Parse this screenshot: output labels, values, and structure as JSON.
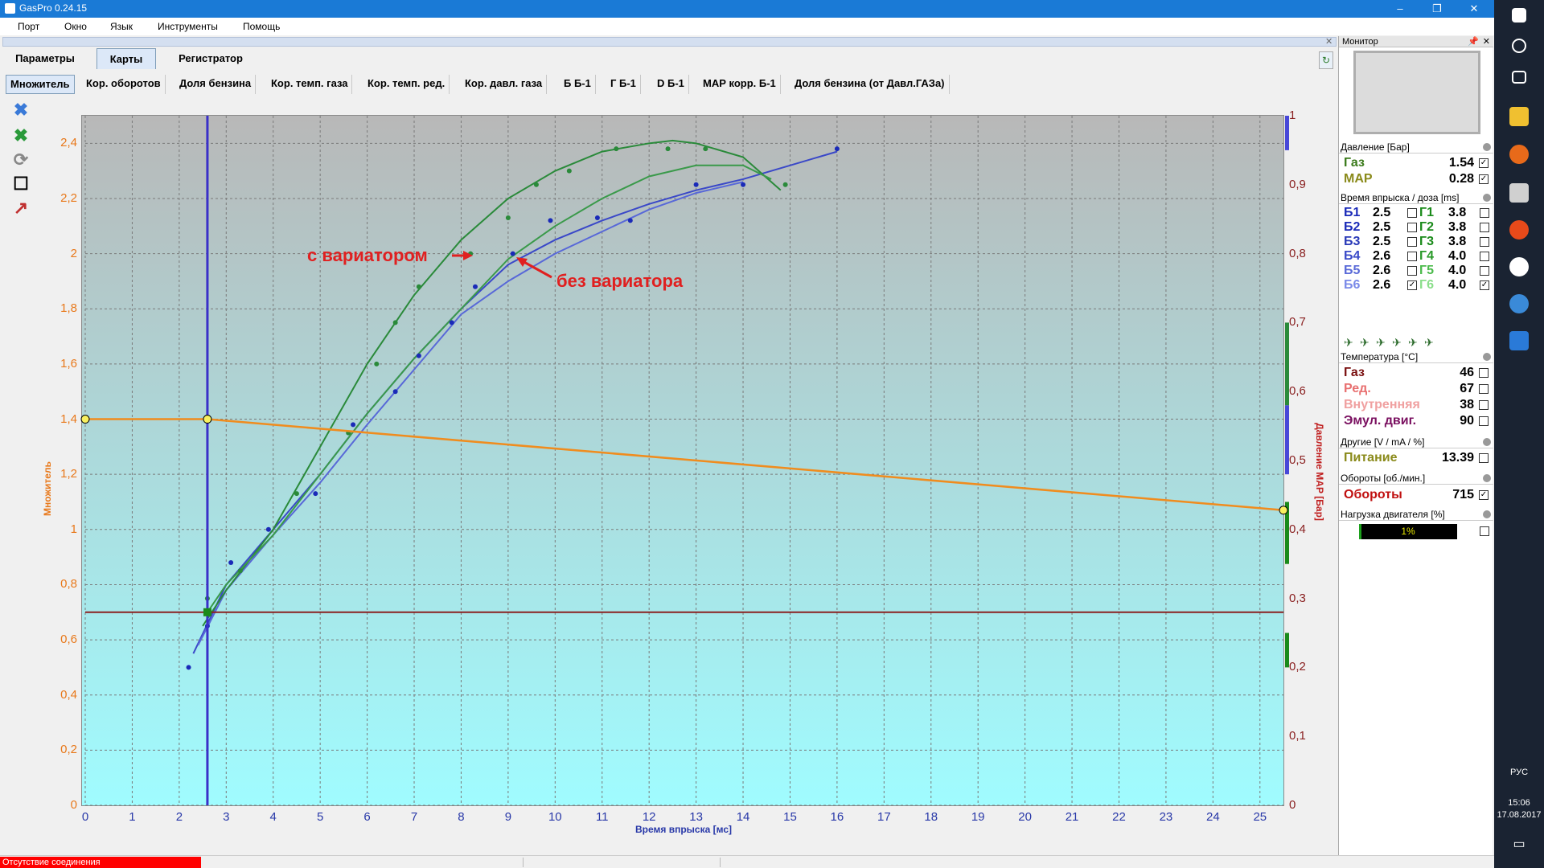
{
  "window": {
    "title": "GasPro 0.24.15"
  },
  "menu": [
    "Порт",
    "Окно",
    "Язык",
    "Инструменты",
    "Помощь"
  ],
  "main_tabs": {
    "params": "Параметры",
    "maps": "Карты",
    "recorder": "Регистратор"
  },
  "sub_tabs": [
    "Множитель",
    "Кор. оборотов",
    "Доля бензина",
    "Кор. темп. газа",
    "Кор. темп. ред.",
    "Кор. давл. газа",
    "Б Б-1",
    "Г Б-1",
    "D Б-1",
    "МАР корр. Б-1",
    "Доля бензина (от Давл.ГАЗа)"
  ],
  "tools": [
    "cancel-x-icon",
    "confirm-x-icon",
    "refresh-icon",
    "frame-icon",
    "graph-edit-icon"
  ],
  "chart_data": {
    "type": "scatter",
    "x_label": "Время впрыска [мс]",
    "y_label": "Множитель",
    "y2_label": "Давление МАР [Бар]",
    "x_ticks": [
      "0",
      "1",
      "2",
      "3",
      "4",
      "5",
      "6",
      "7",
      "8",
      "9",
      "10",
      "11",
      "12",
      "13",
      "14",
      "15",
      "16",
      "17",
      "18",
      "19",
      "20",
      "21",
      "22",
      "23",
      "24",
      "25"
    ],
    "y_ticks": [
      "0",
      "0,2",
      "0,4",
      "0,6",
      "0,8",
      "1",
      "1,2",
      "1,4",
      "1,6",
      "1,8",
      "2",
      "2,2",
      "2,4"
    ],
    "y2_ticks": [
      "0",
      "0,1",
      "0,2",
      "0,3",
      "0,4",
      "0,5",
      "0,6",
      "0,7",
      "0,8",
      "0,9",
      "1"
    ],
    "xlim": [
      0,
      25.5
    ],
    "ylim": [
      0,
      2.5
    ],
    "y2lim": [
      0,
      1
    ],
    "grid": true,
    "multiplier_curve": {
      "x": [
        0,
        2.6,
        25.5
      ],
      "y": [
        1.4,
        1.4,
        1.07
      ],
      "color": "#f08c1e"
    },
    "cursor_x": 2.6,
    "map_pressure_line": {
      "y2": 0.28,
      "color": "#8a2020"
    },
    "series": [
      {
        "role": "blue fit (without variator)",
        "color": "#3a48c8",
        "x": [
          2.3,
          3,
          4,
          5,
          6,
          7,
          8,
          9,
          10,
          11,
          12,
          13,
          14,
          15,
          16
        ],
        "y": [
          0.55,
          0.8,
          1.0,
          1.2,
          1.42,
          1.62,
          1.8,
          1.96,
          2.05,
          2.12,
          2.18,
          2.23,
          2.27,
          2.32,
          2.37
        ]
      },
      {
        "role": "blue fit 2",
        "color": "#5868d8",
        "x": [
          2.4,
          3,
          4,
          5,
          6,
          7,
          8,
          9,
          10,
          11,
          12,
          13,
          14
        ],
        "y": [
          0.58,
          0.78,
          0.98,
          1.17,
          1.38,
          1.58,
          1.78,
          1.9,
          2.0,
          2.08,
          2.16,
          2.22,
          2.26
        ]
      },
      {
        "role": "green fit (with variator)",
        "color": "#2a8a3a",
        "x": [
          2.5,
          3,
          4,
          5,
          6,
          7,
          8,
          9,
          10,
          11,
          12,
          12.5,
          13,
          14,
          14.8
        ],
        "y": [
          0.65,
          0.78,
          1.0,
          1.3,
          1.6,
          1.85,
          2.05,
          2.2,
          2.3,
          2.37,
          2.4,
          2.41,
          2.4,
          2.35,
          2.23
        ]
      },
      {
        "role": "green fit 2",
        "color": "#3a9a4a",
        "x": [
          2.6,
          3,
          4,
          5,
          6,
          7,
          8,
          9,
          10,
          11,
          12,
          13,
          14,
          14.6
        ],
        "y": [
          0.7,
          0.8,
          0.98,
          1.2,
          1.42,
          1.62,
          1.8,
          1.98,
          2.1,
          2.2,
          2.28,
          2.32,
          2.32,
          2.27
        ]
      },
      {
        "role": "dark blue points",
        "color": "#1a2ab8",
        "x": [
          2.2,
          2.6,
          3.1,
          3.9,
          4.9,
          5.7,
          6.6,
          7.1,
          7.8,
          8.3,
          9.1,
          9.9,
          10.9,
          11.6,
          13,
          14,
          16
        ],
        "y": [
          0.5,
          0.65,
          0.88,
          1.0,
          1.13,
          1.38,
          1.5,
          1.63,
          1.75,
          1.88,
          2.0,
          2.12,
          2.13,
          2.12,
          2.25,
          2.25,
          2.38
        ]
      },
      {
        "role": "green points",
        "color": "#2a8a3a",
        "x": [
          2.6,
          3.3,
          4.5,
          5.6,
          6.2,
          6.6,
          7.1,
          8.2,
          9.0,
          9.6,
          10.3,
          11.3,
          12.4,
          13.2,
          14.9
        ],
        "y": [
          0.75,
          0.85,
          1.13,
          1.35,
          1.6,
          1.75,
          1.88,
          2.0,
          2.13,
          2.25,
          2.3,
          2.38,
          2.38,
          2.38,
          2.25
        ]
      }
    ],
    "pressure_bar_right": {
      "segments": [
        {
          "y2_from": 0.95,
          "y2_to": 1.0,
          "color": "#4848d8"
        },
        {
          "y2_from": 0.58,
          "y2_to": 0.7,
          "color": "#2a8a3a"
        },
        {
          "y2_from": 0.48,
          "y2_to": 0.58,
          "color": "#4848d8"
        },
        {
          "y2_from": 0.35,
          "y2_to": 0.44,
          "color": "#1a8a1a"
        },
        {
          "y2_from": 0.2,
          "y2_to": 0.25,
          "color": "#1a8a1a"
        }
      ]
    },
    "annotations": {
      "with_variator": "с вариатором",
      "without_variator": "без вариатора"
    }
  },
  "status": {
    "connection": "Отсутствие соединения"
  },
  "monitor": {
    "title": "Монитор",
    "pressure": {
      "header": "Давление [Бар]",
      "rows": [
        {
          "label": "Газ",
          "value": "1.54",
          "color": "#3a7a1a",
          "checked": "✓"
        },
        {
          "label": "MAP",
          "value": "0.28",
          "color": "#8a8a1a",
          "checked": "✓"
        }
      ]
    },
    "injection": {
      "header": "Время впрыска / доза [ms]",
      "rows": [
        {
          "b": "Б1",
          "bv": "2.5",
          "g": "Г1",
          "gv": "3.8",
          "bcolor": "#1a2ab8",
          "gcolor": "#1a8a1a",
          "bcheck": "",
          "gcheck": ""
        },
        {
          "b": "Б2",
          "bv": "2.5",
          "g": "Г2",
          "gv": "3.8",
          "bcolor": "#1a2ab8",
          "gcolor": "#1a8a1a",
          "bcheck": "",
          "gcheck": ""
        },
        {
          "b": "Б3",
          "bv": "2.5",
          "g": "Г3",
          "gv": "3.8",
          "bcolor": "#2a3ab8",
          "gcolor": "#1a8a1a",
          "bcheck": "",
          "gcheck": ""
        },
        {
          "b": "Б4",
          "bv": "2.6",
          "g": "Г4",
          "gv": "4.0",
          "bcolor": "#3a4ac8",
          "gcolor": "#2a9a2a",
          "bcheck": "",
          "gcheck": ""
        },
        {
          "b": "Б5",
          "bv": "2.6",
          "g": "Г5",
          "gv": "4.0",
          "bcolor": "#5a6ad8",
          "gcolor": "#4aba4a",
          "bcheck": "",
          "gcheck": ""
        },
        {
          "b": "Б6",
          "bv": "2.6",
          "g": "Г6",
          "gv": "4.0",
          "bcolor": "#7a8ae8",
          "gcolor": "#8ade8a",
          "bcheck": "✓",
          "gcheck": "✓"
        }
      ]
    },
    "temperature": {
      "header": "Температура [°C]",
      "rows": [
        {
          "label": "Газ",
          "value": "46",
          "color": "#7a1010"
        },
        {
          "label": "Ред.",
          "value": "67",
          "color": "#e87070"
        },
        {
          "label": "Внутренняя",
          "value": "38",
          "color": "#f0a0a0"
        },
        {
          "label": "Эмул. двиг.",
          "value": "90",
          "color": "#7a1060"
        }
      ]
    },
    "other": {
      "header": "Другие [V / mA / %]",
      "rows": [
        {
          "label": "Питание",
          "value": "13.39",
          "color": "#8a8a1a"
        }
      ]
    },
    "rpm": {
      "header": "Обороты [об./мин.]",
      "rows": [
        {
          "label": "Обороты",
          "value": "715",
          "color": "#c01010",
          "checked": "✓"
        }
      ]
    },
    "load": {
      "header": "Нагрузка двигателя [%]",
      "value": "1%"
    }
  },
  "taskbar": {
    "lang": "РУС",
    "time": "15:06",
    "date": "17.08.2017"
  }
}
